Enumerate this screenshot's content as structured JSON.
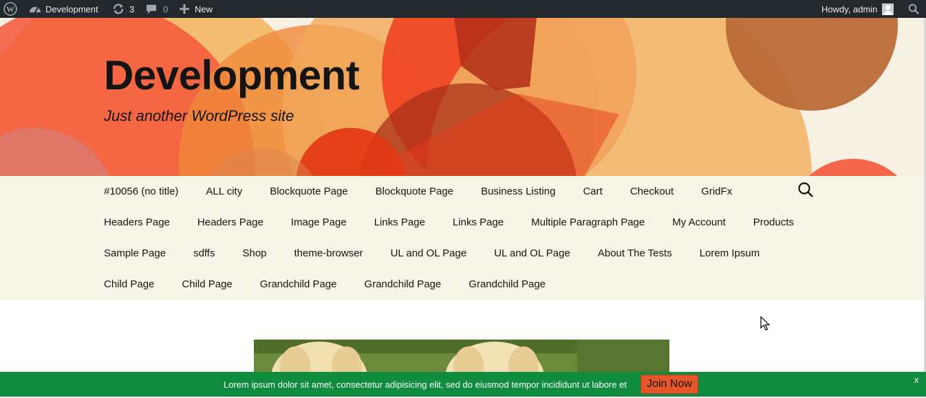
{
  "adminbar": {
    "wp_logo_icon": "wordpress-icon",
    "site_name": "Development",
    "updates_count": "3",
    "comments_count": "0",
    "new_label": "New",
    "greeting": "Howdy, admin"
  },
  "header": {
    "site_title": "Development",
    "site_description": "Just another WordPress site"
  },
  "nav": {
    "rows": [
      [
        "#10056 (no title)",
        "ALL city",
        "Blockquote Page",
        "Blockquote Page",
        "Business Listing",
        "Cart",
        "Checkout",
        "GridFx"
      ],
      [
        "Headers Page",
        "Headers Page",
        "Image Page",
        "Links Page",
        "Links Page",
        "Multiple Paragraph Page",
        "My Account",
        "Products"
      ],
      [
        "Sample Page",
        "sdffs",
        "Shop",
        "theme-browser",
        "UL and OL Page",
        "UL and OL Page",
        "About The Tests",
        "Lorem Ipsum"
      ],
      [
        "Child Page",
        "Child Page",
        "Grandchild Page",
        "Grandchild Page",
        "Grandchild Page"
      ]
    ]
  },
  "notice": {
    "text": "Lorem ipsum dolor sit amet, consectetur adipisicing elit, sed do eiusmod tempor incididunt ut labore et",
    "button_label": "Join Now",
    "close_label": "x"
  },
  "colors": {
    "adminbar_bg": "#23282d",
    "header_bg": "#f7f1e3",
    "nav_bg": "#f7f5e7",
    "notice_bg": "#0f8c3e",
    "button_bg": "#e8572b"
  }
}
